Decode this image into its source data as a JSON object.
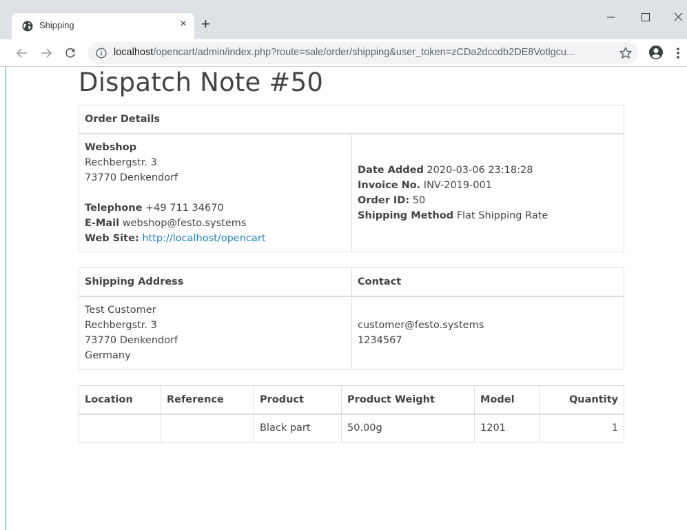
{
  "browser": {
    "tab_title": "Shipping",
    "tab_close": "×",
    "new_tab": "+",
    "url_host": "localhost",
    "url_path": "/opencart/admin/index.php?route=sale/order/shipping&user_token=zCDa2dccdb2DE8Votlgcu..."
  },
  "page": {
    "title": "Dispatch Note #50"
  },
  "order_details": {
    "header": "Order Details",
    "store_name": "Webshop",
    "address_line1": "Rechbergstr. 3",
    "address_line2": "73770 Denkendorf",
    "telephone_label": "Telephone",
    "telephone_value": "+49 711 34670",
    "email_label": "E-Mail",
    "email_value": "webshop@festo.systems",
    "website_label": "Web Site:",
    "website_value": "http://localhost/opencart",
    "date_added_label": "Date Added",
    "date_added_value": "2020-03-06 23:18:28",
    "invoice_label": "Invoice No.",
    "invoice_value": "INV-2019-001",
    "order_id_label": "Order ID:",
    "order_id_value": "50",
    "shipping_method_label": "Shipping Method",
    "shipping_method_value": "Flat Shipping Rate"
  },
  "shipping": {
    "address_header": "Shipping Address",
    "contact_header": "Contact",
    "address_lines": [
      "Test Customer",
      "Rechbergstr. 3",
      "73770 Denkendorf",
      "Germany"
    ],
    "contact_email": "customer@festo.systems",
    "contact_phone": "1234567"
  },
  "products": {
    "headers": [
      "Location",
      "Reference",
      "Product",
      "Product Weight",
      "Model",
      "Quantity"
    ],
    "rows": [
      {
        "location": "",
        "reference": "",
        "product": "Black part",
        "weight": "50.00g",
        "model": "1201",
        "quantity": "1"
      }
    ]
  }
}
